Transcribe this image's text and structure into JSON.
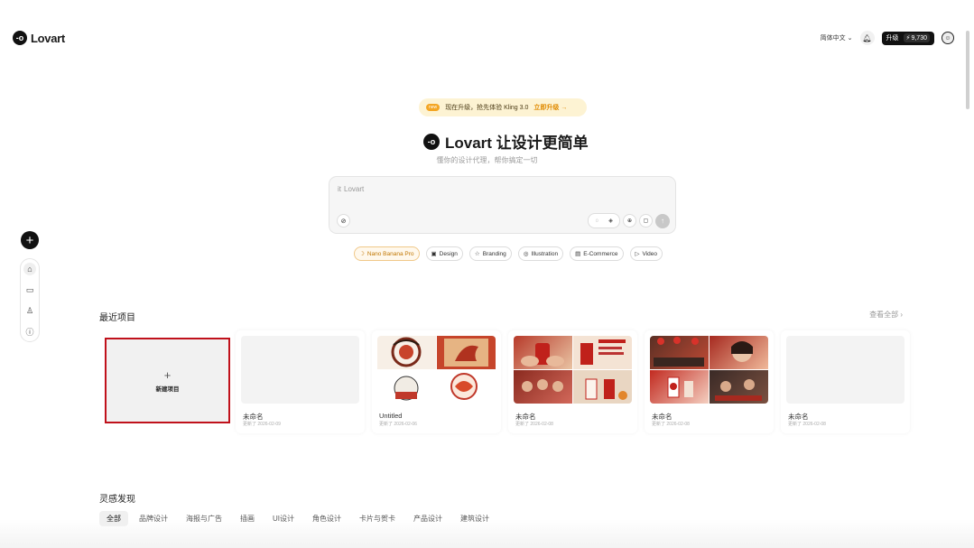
{
  "header": {
    "brand": "Lovart",
    "brand_mark": "-o",
    "language": "简体中文",
    "upgrade_label": "升级",
    "credits": "9,730"
  },
  "banner": {
    "badge": "new",
    "text": "现在升级，抢先体验 Kling 3.0",
    "link": "立即升级 →"
  },
  "hero": {
    "title": "Lovart 让设计更简单",
    "subtitle": "懂你的设计代理，帮你搞定一切"
  },
  "prompt": {
    "placeholder": "Lovart",
    "placeholder_prefix": "it"
  },
  "chips": [
    {
      "label": "Nano Banana Pro",
      "icon": "banana-icon"
    },
    {
      "label": "Design",
      "icon": "image-icon"
    },
    {
      "label": "Branding",
      "icon": "star-icon"
    },
    {
      "label": "Illustration",
      "icon": "palette-icon"
    },
    {
      "label": "E-Commerce",
      "icon": "store-icon"
    },
    {
      "label": "Video",
      "icon": "play-icon"
    }
  ],
  "recent": {
    "title": "最近项目",
    "view_all": "查看全部",
    "new_project": "新建项目",
    "cards": [
      {
        "name": "未命名",
        "date": "更新了 2026-02-09"
      },
      {
        "name": "Untitled",
        "date": "更新了 2026-02-06"
      },
      {
        "name": "未命名",
        "date": "更新了 2026-02-08"
      },
      {
        "name": "未命名",
        "date": "更新了 2026-02-08"
      },
      {
        "name": "未命名",
        "date": "更新了 2026-02-08"
      }
    ]
  },
  "inspiration": {
    "title": "灵感发现",
    "tabs": [
      "全部",
      "品牌设计",
      "海报与广告",
      "插画",
      "UI设计",
      "角色设计",
      "卡片与贺卡",
      "产品设计",
      "建筑设计"
    ]
  },
  "colors": {
    "accent_red": "#c0111b",
    "banner_bg": "#fdf3d3",
    "brand_dark": "#111111"
  }
}
